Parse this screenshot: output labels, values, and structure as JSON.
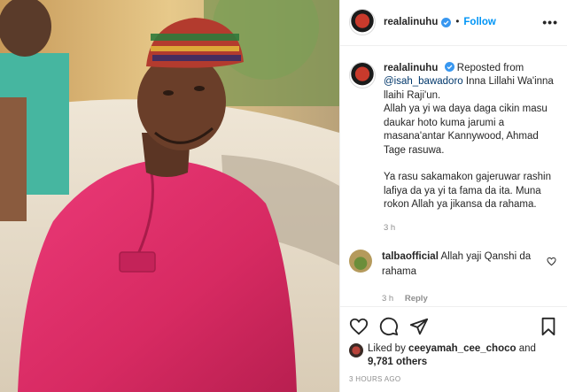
{
  "post": {
    "username": "realalinuhu",
    "follow_label": "Follow",
    "more_label": "•••",
    "caption": {
      "username": "realalinuhu",
      "repost_prefix": "Reposted from",
      "mention": "@isah_bawadoro",
      "line1_rest": "Inna Lillahi Wa'inna llaihi Raji'un.",
      "para2": "Allah ya yi wa daya daga cikin masu daukar hoto kuma jarumi a masana'antar Kannywood, Ahmad Tage rasuwa.",
      "para3": "Ya rasu sakamakon gajeruwar rashin lafiya da ya yi ta fama da ita. Muna rokon Allah ya jikansa da rahama.",
      "time": "3 h"
    },
    "comment": {
      "username": "talbaofficial",
      "text": "Allah yaji Qanshi da rahama",
      "time": "3 h",
      "reply_label": "Reply"
    },
    "likes": {
      "prefix": "Liked by",
      "user": "ceeyamah_cee_choco",
      "and": "and",
      "count": "9,781 others"
    },
    "posted_ago": "3 HOURS AGO",
    "colors": {
      "accent_blue": "#0095f6",
      "mention_blue": "#00376b",
      "muted": "#8e8e8e",
      "robe_pink": "#e0306a"
    }
  }
}
